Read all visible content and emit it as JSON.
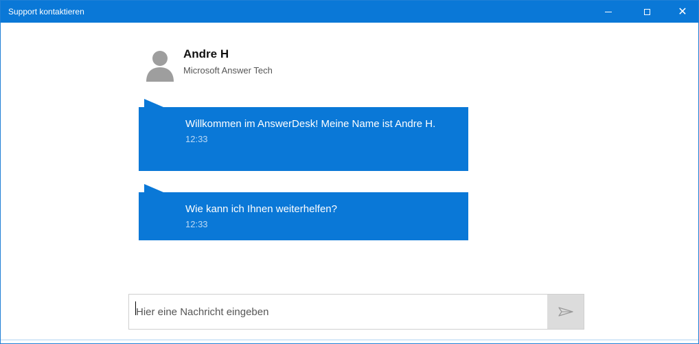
{
  "window": {
    "title": "Support kontaktieren",
    "accent_color": "#0a78d7"
  },
  "agent": {
    "name": "Andre H",
    "role": "Microsoft Answer Tech",
    "avatar_icon": "person-silhouette-icon"
  },
  "messages": [
    {
      "text": "Willkommen im AnswerDesk! Meine Name ist Andre H.",
      "time": "12:33"
    },
    {
      "text": "Wie kann ich Ihnen weiterhelfen?",
      "time": "12:33"
    }
  ],
  "composer": {
    "placeholder": "Hier eine Nachricht eingeben",
    "value": "",
    "send_icon": "send-arrow-icon"
  }
}
